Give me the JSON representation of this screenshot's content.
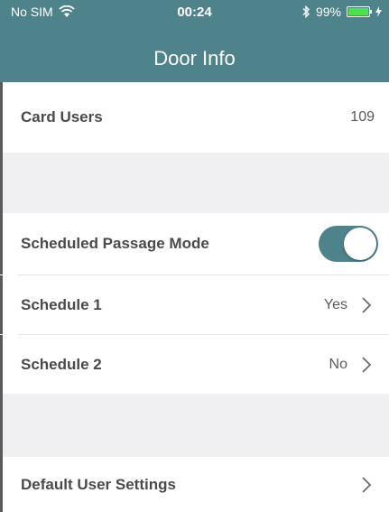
{
  "status_bar": {
    "carrier": "No SIM",
    "time": "00:24",
    "battery_percent_text": "99%",
    "battery_level": 0.99
  },
  "nav": {
    "title": "Door Info"
  },
  "rows": {
    "card_users": {
      "label": "Card Users",
      "value": "109"
    },
    "scheduled_passage_mode": {
      "label": "Scheduled Passage Mode",
      "enabled": true
    },
    "schedule_1": {
      "label": "Schedule 1",
      "value": "Yes"
    },
    "schedule_2": {
      "label": "Schedule 2",
      "value": "No"
    },
    "default_user_settings": {
      "label": "Default User Settings"
    }
  },
  "colors": {
    "accent": "#4e838b",
    "section_background": "#f0f0f3",
    "battery_fill": "#4fe04f"
  }
}
